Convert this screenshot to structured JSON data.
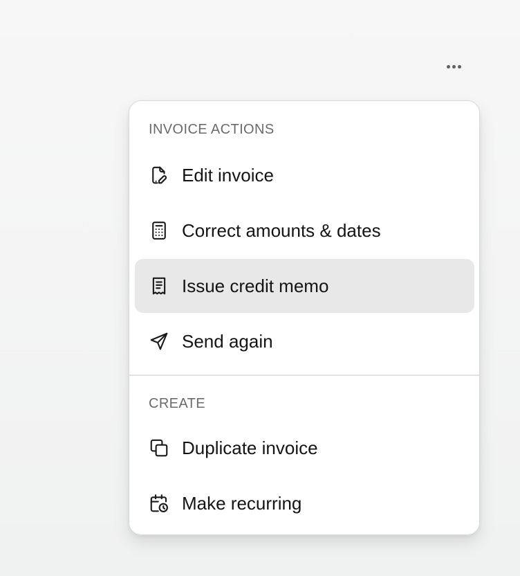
{
  "toolbar": {
    "more_icon": "more-horizontal-icon"
  },
  "menu": {
    "sections": [
      {
        "heading": "INVOICE ACTIONS",
        "items": [
          {
            "label": "Edit invoice",
            "icon": "edit-document-icon"
          },
          {
            "label": "Correct amounts & dates",
            "icon": "calculator-icon"
          },
          {
            "label": "Issue credit memo",
            "icon": "receipt-icon",
            "active": true
          },
          {
            "label": "Send again",
            "icon": "send-icon"
          }
        ]
      },
      {
        "heading": "CREATE",
        "items": [
          {
            "label": "Duplicate invoice",
            "icon": "copy-icon"
          },
          {
            "label": "Make recurring",
            "icon": "calendar-clock-icon"
          }
        ]
      }
    ]
  },
  "colors": {
    "background": "#f4f5f5",
    "menu_background": "#ffffff",
    "active_item": "#e8e8e8",
    "heading_text": "#6a6a6a",
    "item_text": "#141414"
  }
}
